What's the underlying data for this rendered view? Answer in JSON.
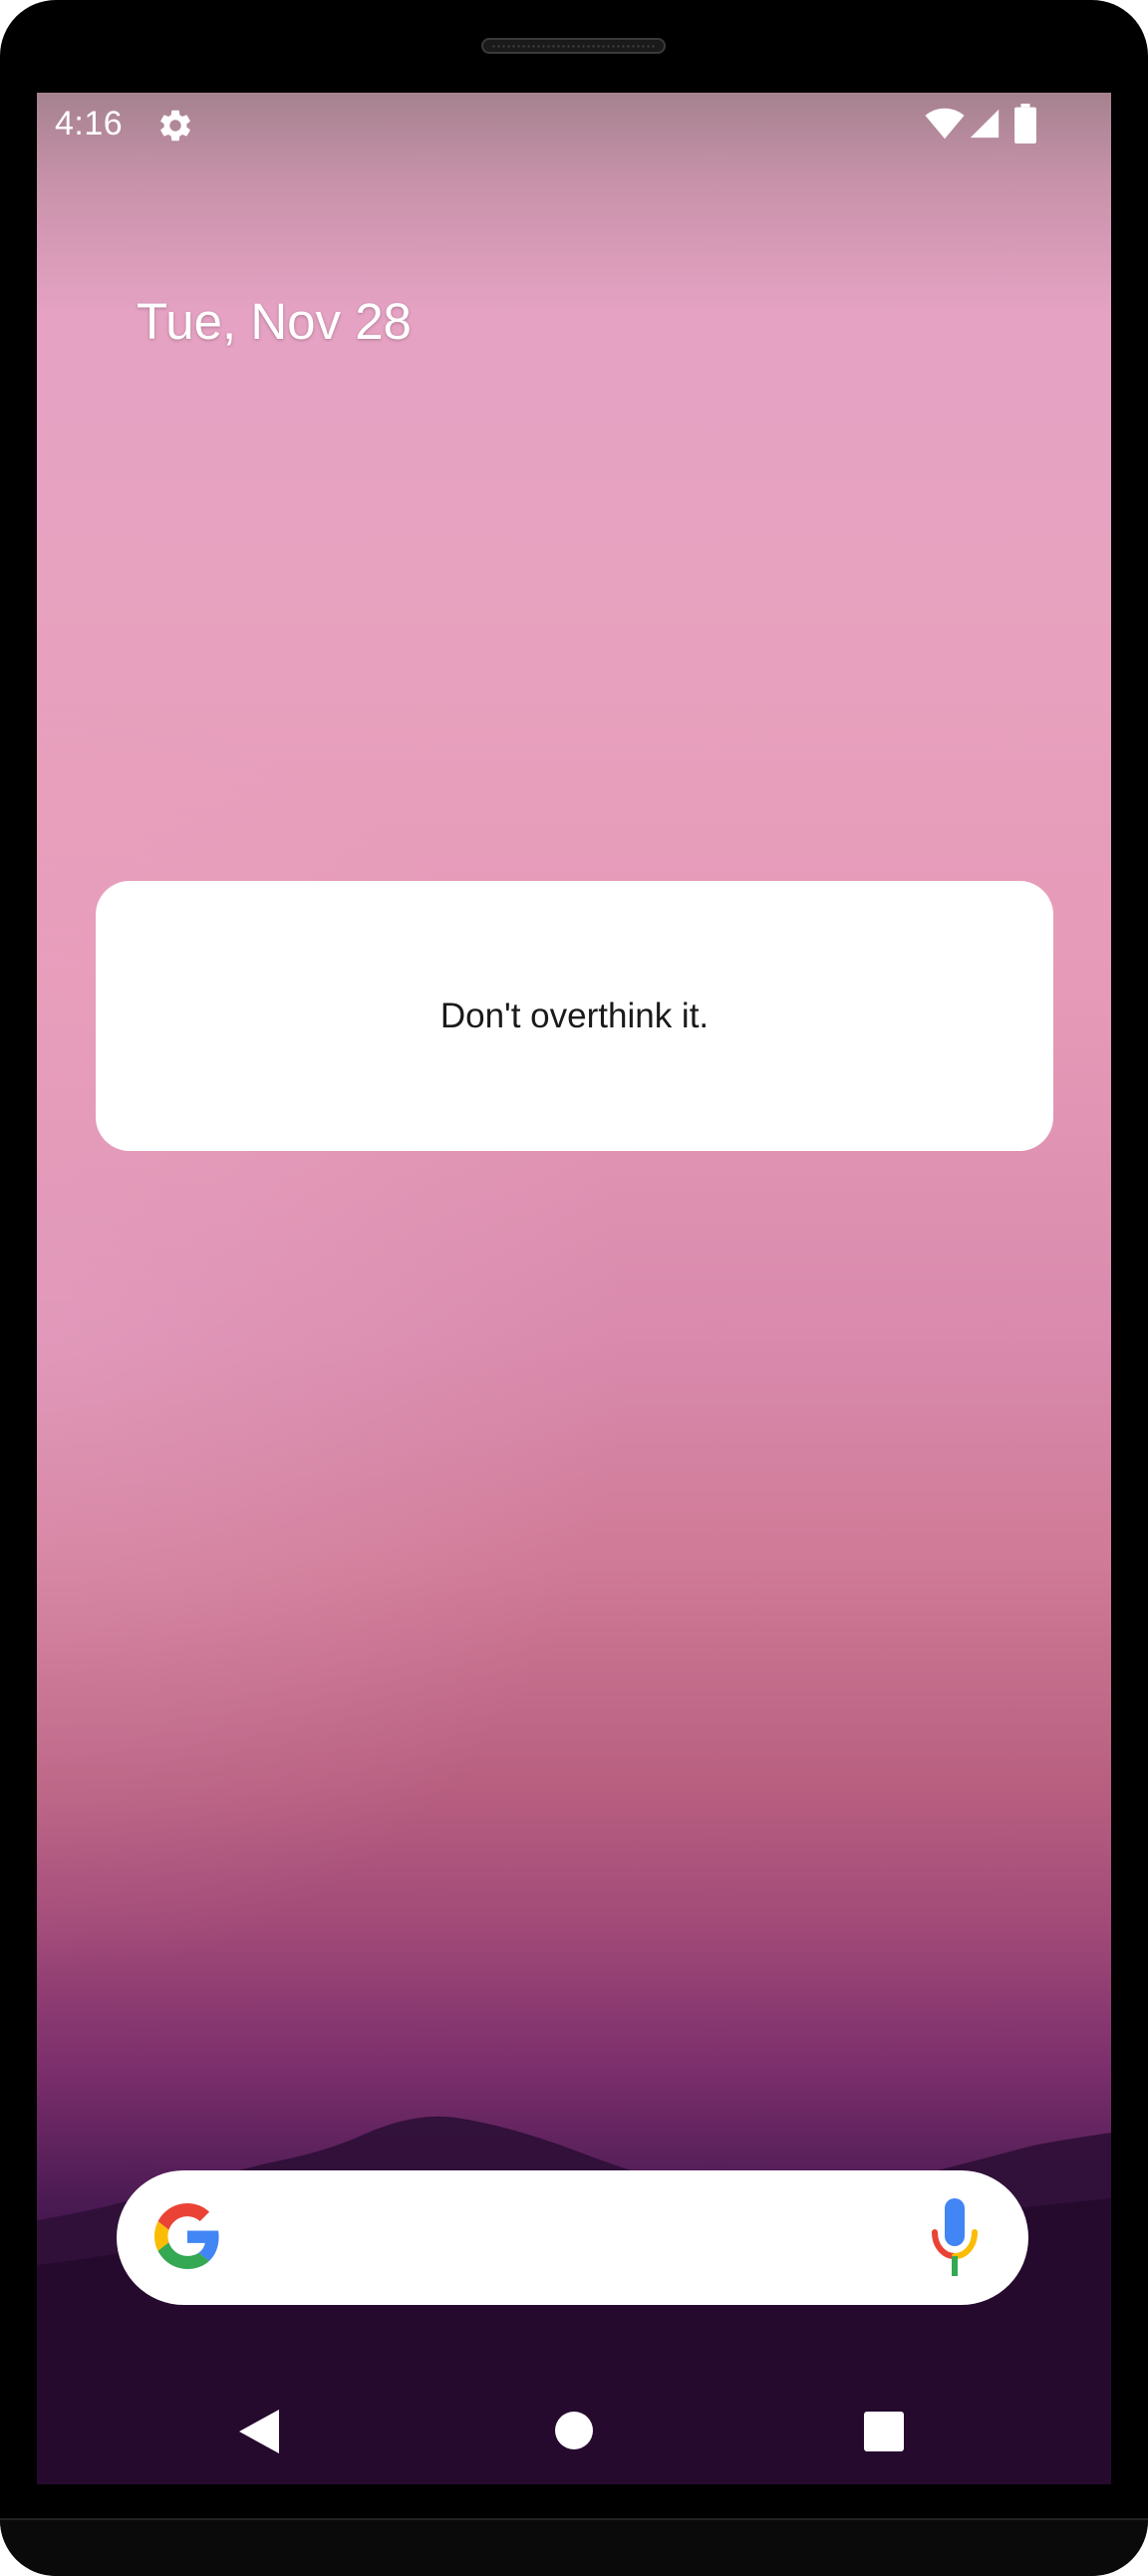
{
  "status_bar": {
    "time": "4:16",
    "icons": [
      "gear-icon",
      "wifi-icon",
      "cell-signal-icon",
      "battery-icon"
    ]
  },
  "home": {
    "date": "Tue, Nov 28"
  },
  "quote_widget": {
    "text": "Don't overthink it."
  },
  "search_widget": {
    "logo_icon": "google-g-icon",
    "mic_icon": "microphone-icon"
  },
  "nav_bar": {
    "back_icon": "back-triangle-icon",
    "home_icon": "home-circle-icon",
    "recents_icon": "recents-square-icon"
  },
  "colors": {
    "accent_pink": "#e7a2bf",
    "dusk_purple": "#4a1a53",
    "google_blue": "#4285F4",
    "google_red": "#EA4335",
    "google_yellow": "#FBBC05",
    "google_green": "#34A853"
  }
}
